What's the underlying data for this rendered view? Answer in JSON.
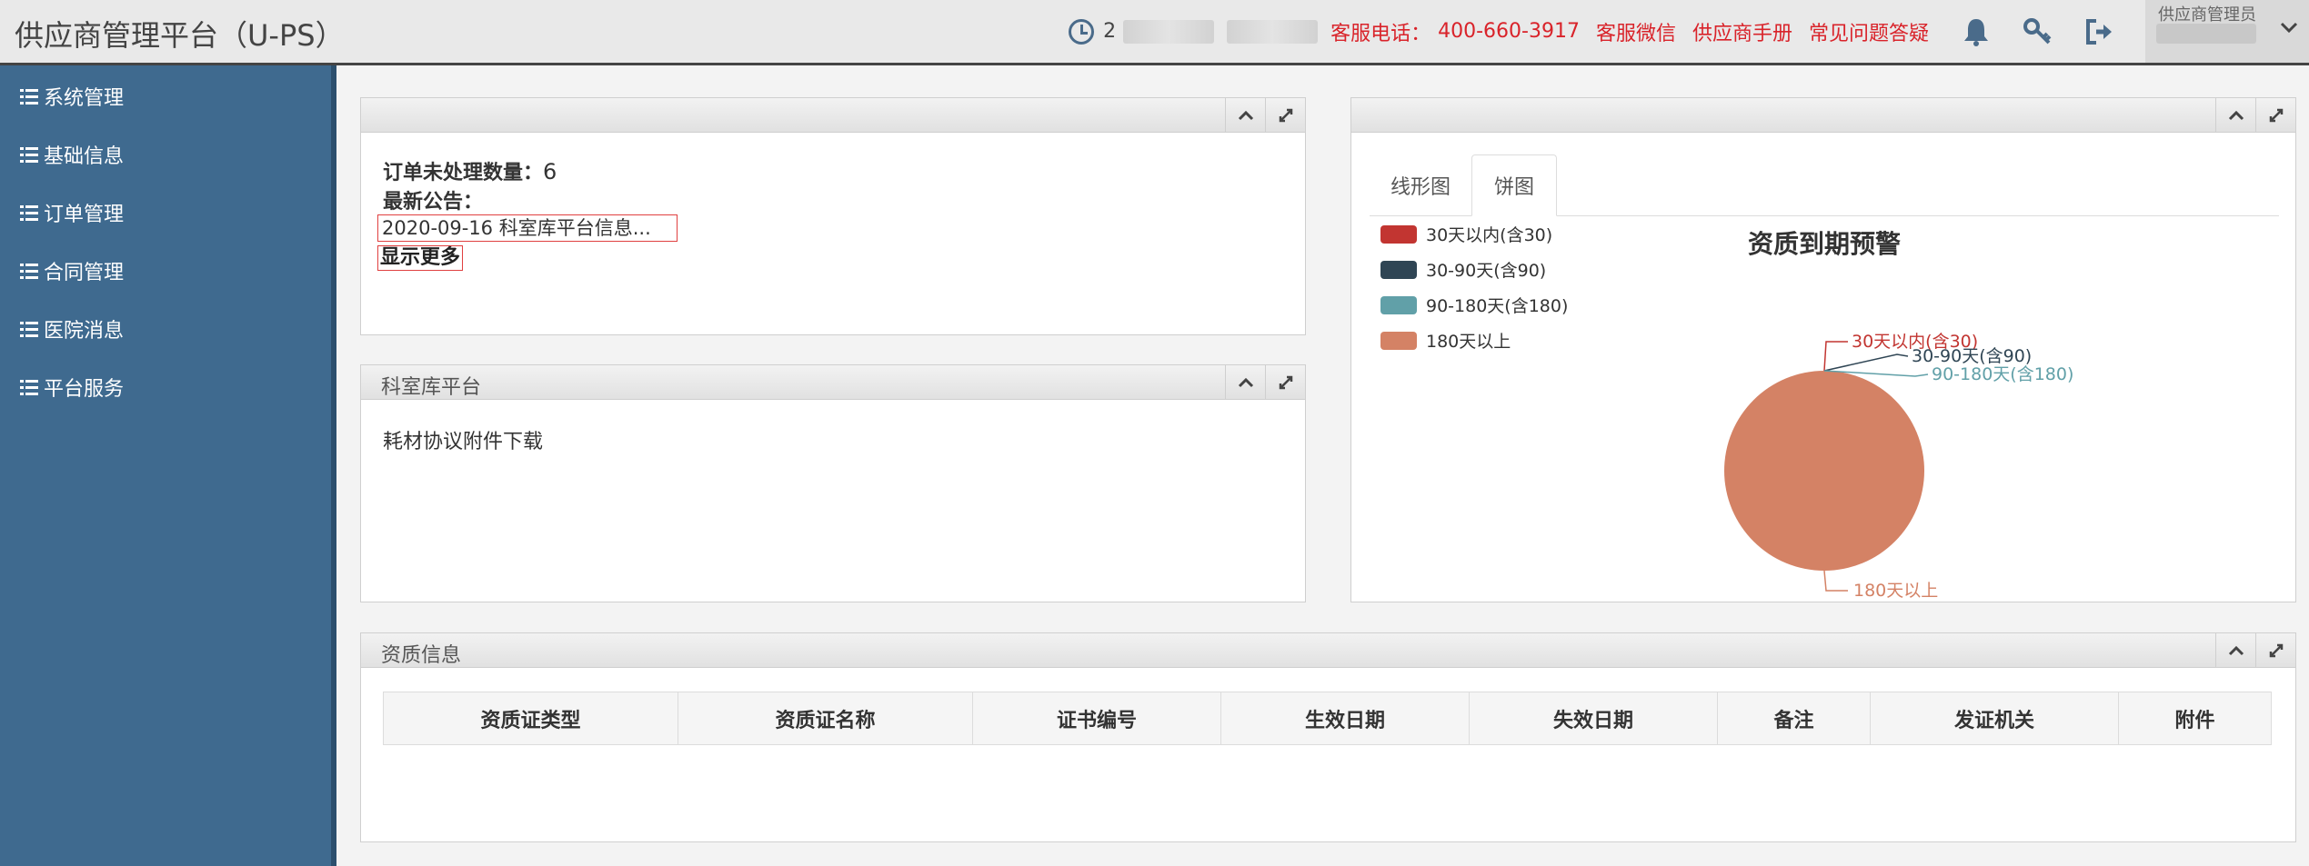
{
  "header": {
    "title": "供应商管理平台（U-PS）",
    "clock_text": "2",
    "links": [
      "客服电话：",
      "400-660-3917",
      "客服微信",
      "供应商手册",
      "常见问题答疑"
    ],
    "user_label": "供应商管理员",
    "icons": [
      "clock-icon",
      "bell-icon",
      "key-icon",
      "logout-icon",
      "chevron-down-icon"
    ]
  },
  "sidebar": {
    "items": [
      {
        "label": "系统管理"
      },
      {
        "label": "基础信息"
      },
      {
        "label": "订单管理"
      },
      {
        "label": "合同管理"
      },
      {
        "label": "医院消息"
      },
      {
        "label": "平台服务"
      }
    ]
  },
  "notice_panel": {
    "title": "",
    "pending_label": "订单未处理数量：",
    "pending_count": "6",
    "announce_label": "最新公告：",
    "announcement": "2020-09-16 科室库平台信息...",
    "show_more": "显示更多"
  },
  "kesk_panel": {
    "title": "科室库平台",
    "content": "耗材协议附件下载"
  },
  "chart_panel": {
    "tabs": [
      "线形图",
      "饼图"
    ],
    "active_tab": "饼图"
  },
  "chart_data": {
    "type": "pie",
    "title": "资质到期预警",
    "legend_position": "top-left",
    "categories": [
      "30天以内(含30)",
      "30-90天(含90)",
      "90-180天(含180)",
      "180天以上"
    ],
    "values": [
      0,
      0,
      0,
      100
    ],
    "colors": [
      "#c23531",
      "#2f4554",
      "#61a0a8",
      "#d48265"
    ]
  },
  "qualification_panel": {
    "title": "资质信息",
    "columns": [
      "资质证类型",
      "资质证名称",
      "证书编号",
      "生效日期",
      "失效日期",
      "备注",
      "发证机关",
      "附件"
    ]
  }
}
